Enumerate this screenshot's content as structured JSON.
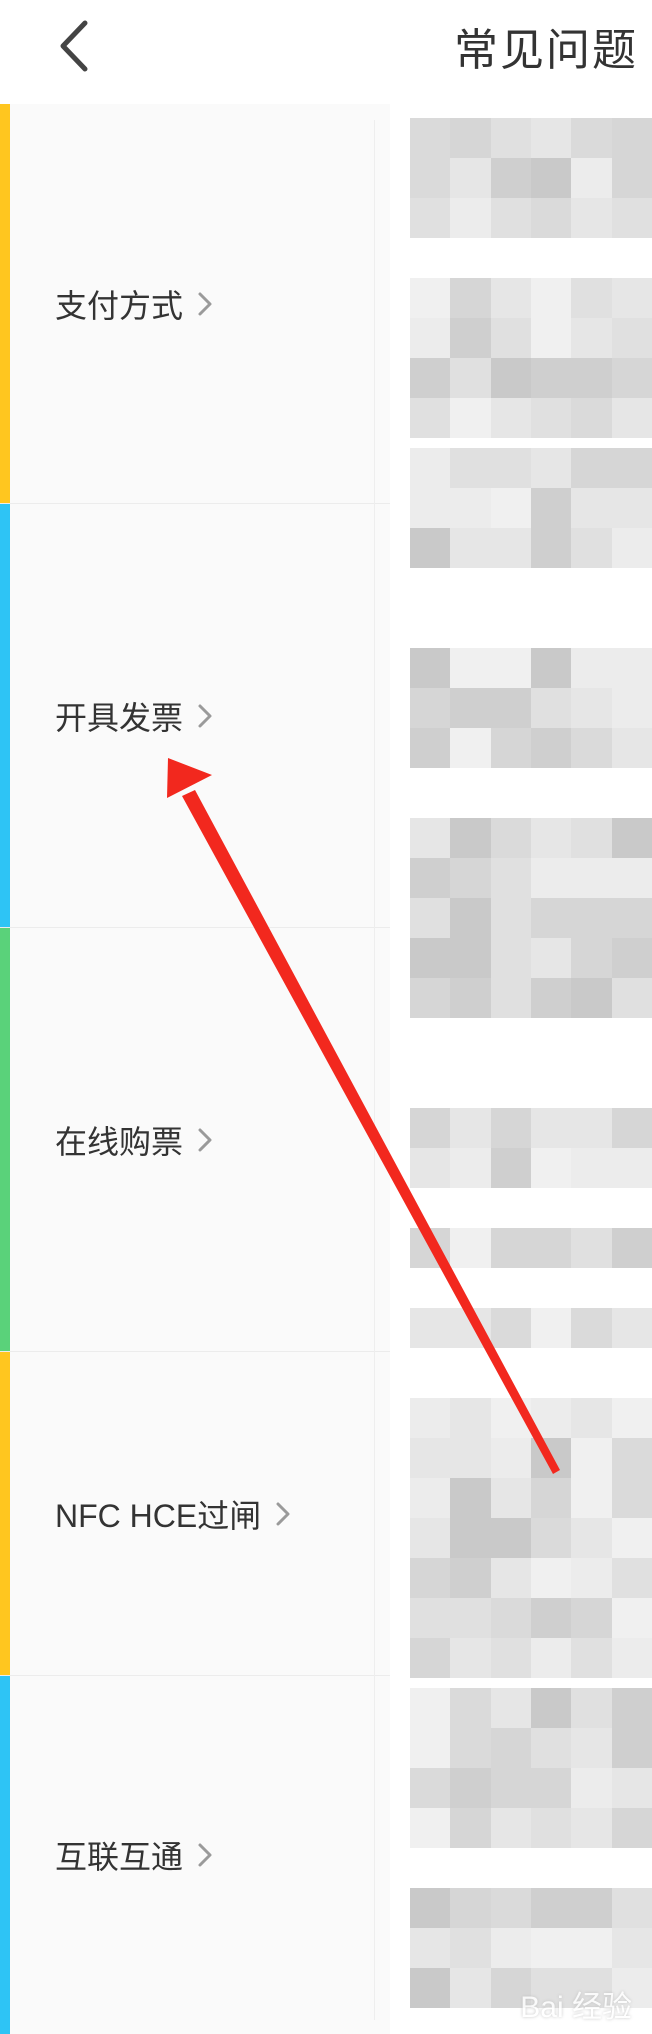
{
  "header": {
    "title": "常见问题",
    "back_icon": "chevron-left-icon"
  },
  "categories": [
    {
      "label": "支付方式",
      "color": "#FFC61F"
    },
    {
      "label": "开具发票",
      "color": "#2EC4F5"
    },
    {
      "label": "在线购票",
      "color": "#5AD27A"
    },
    {
      "label": "NFC HCE过闸",
      "color": "#FFC61F"
    },
    {
      "label": "互联互通",
      "color": "#2EC4F5"
    }
  ],
  "annotation": {
    "type": "arrow",
    "color": "#F2281E",
    "target": "开具发票"
  },
  "watermark": {
    "text": "Bai 经验"
  }
}
